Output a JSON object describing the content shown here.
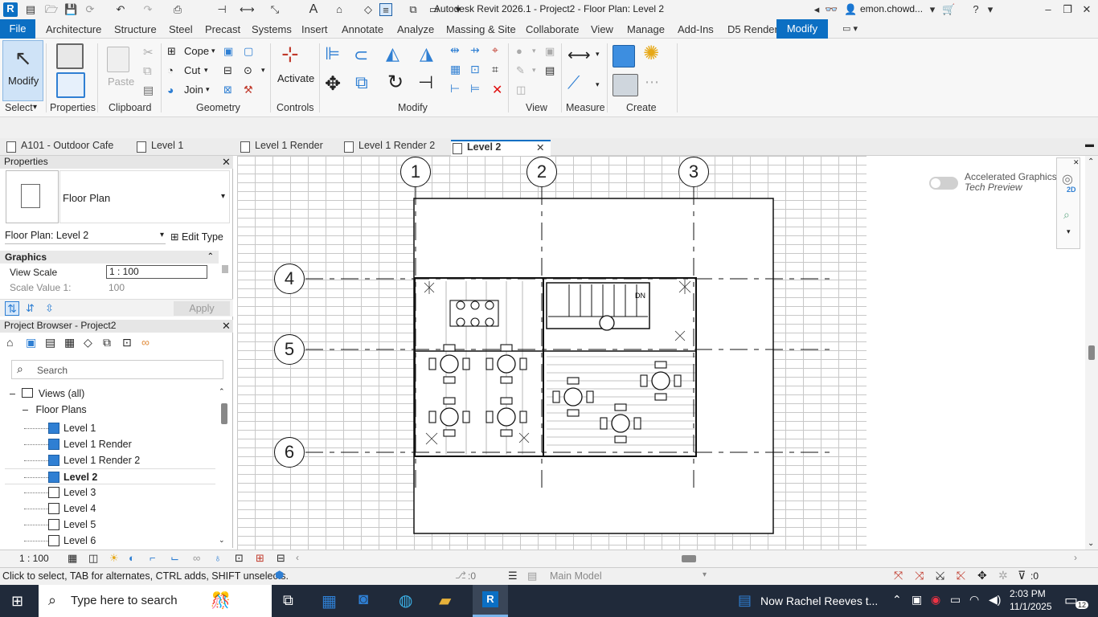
{
  "window": {
    "title": "Autodesk Revit 2026.1 - Project2 - Floor Plan: Level 2",
    "user": "emon.chowd..."
  },
  "menu": {
    "file": "File",
    "tabs": [
      "Architecture",
      "Structure",
      "Steel",
      "Precast",
      "Systems",
      "Insert",
      "Annotate",
      "Analyze",
      "Massing & Site",
      "Collaborate",
      "View",
      "Manage",
      "Add-Ins",
      "D5 Render"
    ],
    "active": "Modify"
  },
  "ribbon": {
    "select": {
      "label": "Modify",
      "panel": "Select"
    },
    "properties": {
      "panel": "Properties"
    },
    "clipboard": {
      "paste": "Paste",
      "panel": "Clipboard"
    },
    "geometry": {
      "cope": "Cope",
      "cut": "Cut",
      "join": "Join",
      "panel": "Geometry"
    },
    "controls": {
      "activate": "Activate",
      "panel": "Controls"
    },
    "modify": {
      "panel": "Modify"
    },
    "view": {
      "panel": "View"
    },
    "measure": {
      "panel": "Measure"
    },
    "create": {
      "panel": "Create"
    }
  },
  "view_tabs": [
    {
      "label": "A101 - Outdoor Cafe",
      "active": false
    },
    {
      "label": "Level 1",
      "active": false
    },
    {
      "label": "Level 1 Render",
      "active": false
    },
    {
      "label": "Level 1 Render 2",
      "active": false
    },
    {
      "label": "Level 2",
      "active": true
    }
  ],
  "properties": {
    "title": "Properties",
    "type_name": "Floor Plan",
    "selector": "Floor Plan: Level 2",
    "edit_type": "Edit Type",
    "section": "Graphics",
    "rows": [
      {
        "name": "View Scale",
        "value": "1 : 100"
      },
      {
        "name": "Scale Value    1:",
        "value": "100"
      }
    ],
    "apply": "Apply"
  },
  "project_browser": {
    "title": "Project Browser - Project2",
    "search_placeholder": "Search",
    "views_all": "Views (all)",
    "floor_plans": "Floor Plans",
    "levels": [
      {
        "label": "Level 1",
        "filled": true,
        "bold": false
      },
      {
        "label": "Level 1 Render",
        "filled": true,
        "bold": false
      },
      {
        "label": "Level 1 Render 2",
        "filled": true,
        "bold": false
      },
      {
        "label": "Level 2",
        "filled": true,
        "bold": true
      },
      {
        "label": "Level 3",
        "filled": false,
        "bold": false
      },
      {
        "label": "Level 4",
        "filled": false,
        "bold": false
      },
      {
        "label": "Level 5",
        "filled": false,
        "bold": false
      },
      {
        "label": "Level 6",
        "filled": false,
        "bold": false
      }
    ]
  },
  "canvas": {
    "grids_vertical": [
      "1",
      "2",
      "3"
    ],
    "grids_horizontal": [
      "4",
      "5",
      "6"
    ],
    "accel_label_1": "Accelerated Graphics",
    "accel_label_2": "Tech Preview",
    "stair_label": "DN",
    "nav_2d": "2D"
  },
  "view_control": {
    "scale": "1 : 100"
  },
  "status": {
    "hint": "Click to select, TAB for alternates, CTRL adds, SHIFT unselects.",
    "worksets": ":0",
    "model": "Main Model",
    "filter": ":0"
  },
  "taskbar": {
    "search_placeholder": "Type here to search",
    "news": "Now Rachel Reeves t...",
    "time": "2:03 PM",
    "date": "11/1/2025",
    "notif_count": "12"
  }
}
